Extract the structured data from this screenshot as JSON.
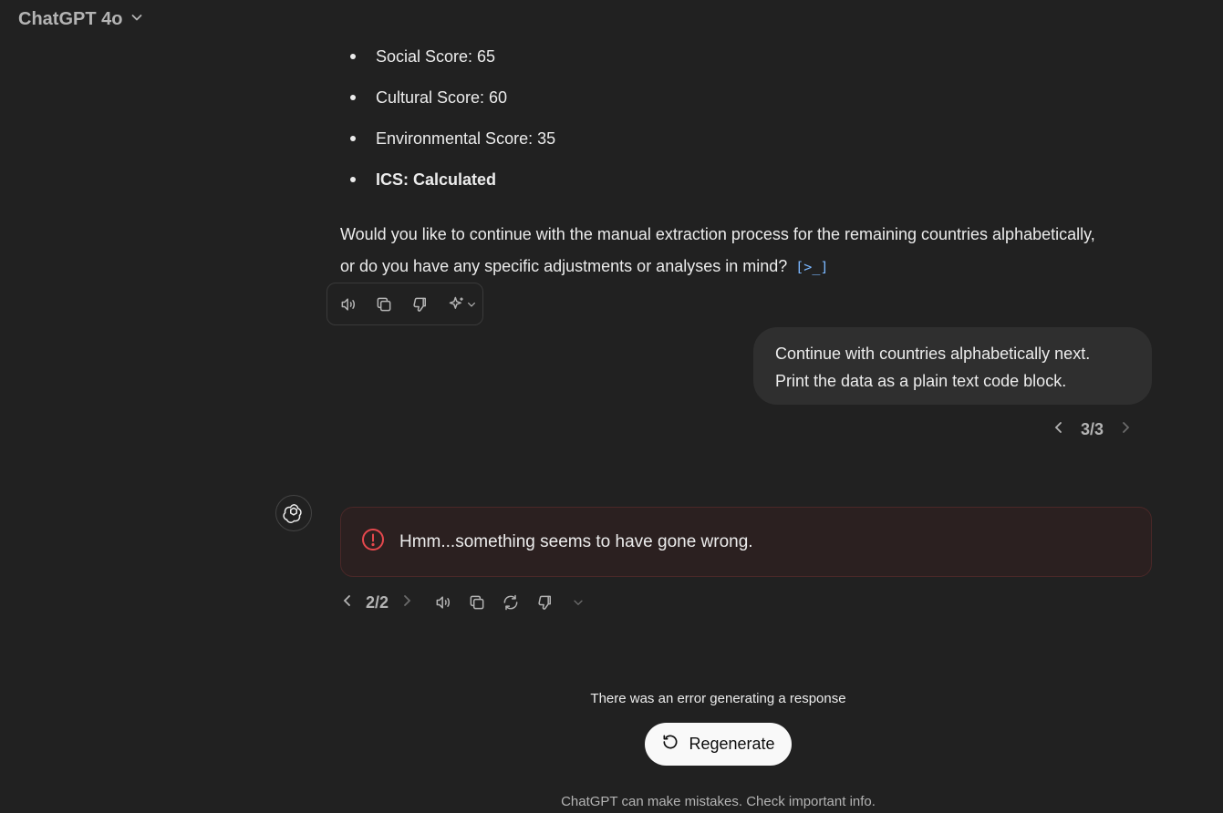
{
  "header": {
    "model_name": "ChatGPT 4o",
    "dropdown_icon": "chevron-down-icon"
  },
  "assistant_message_1": {
    "bullets": [
      "Social Score: 65",
      "Cultural Score: 60",
      "Environmental Score: 35",
      "ICS: Calculated"
    ],
    "paragraph": "Would you like to continue with the manual extraction process for the remaining countries alphabetically, or do you have any specific adjustments or analyses in mind?",
    "citation_glyph": "[>_]",
    "toolbar_icons": [
      "read-aloud-icon",
      "copy-icon",
      "thumbs-down-icon",
      "sparkle-icon",
      "chevron-down-icon"
    ]
  },
  "user_message": {
    "lines": [
      "Continue with countries alphabetically next.",
      "Print the data as a plain text code block."
    ],
    "pager": "3/3"
  },
  "assistant_message_2": {
    "error_text": "Hmm...something seems to have gone wrong.",
    "pager": "2/2",
    "toolbar_icons": [
      "read-aloud-icon",
      "copy-icon",
      "regenerate-icon",
      "thumbs-down-icon",
      "chevron-down-icon"
    ]
  },
  "bottom": {
    "error_note": "There was an error generating a response",
    "regenerate_label": "Regenerate",
    "disclaimer": "ChatGPT can make mistakes. Check important info."
  },
  "colors": {
    "background": "#212121",
    "user_bubble": "#2f2f2f",
    "error_icon": "#e5484d",
    "error_border": "#4b2828",
    "citation": "#7ab7ff"
  }
}
